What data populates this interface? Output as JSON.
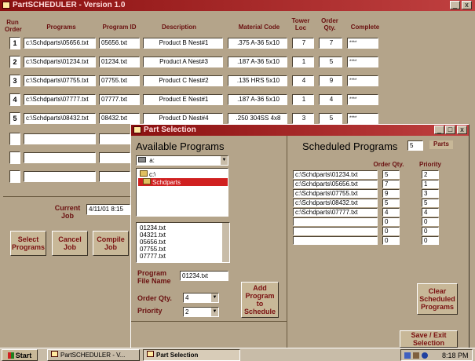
{
  "main_window": {
    "title": "PartSCHEDULER - Version 1.0",
    "headers": {
      "run_order": "Run Order",
      "programs": "Programs",
      "program_id": "Program ID",
      "description": "Description",
      "material_code": "Material Code",
      "tower_loc": "Tower Loc",
      "order_qty": "Order Qty.",
      "complete": "Complete"
    },
    "rows": [
      {
        "order": "1",
        "program": "c:\\Schdparts\\05656.txt",
        "id": "05656.txt",
        "desc": "Product B Nest#1",
        "material": ".375 A-36 5x10",
        "tower": "7",
        "qty": "7",
        "complete": "****"
      },
      {
        "order": "2",
        "program": "c:\\Schdparts\\01234.txt",
        "id": "01234.txt",
        "desc": "Product A Nest#3",
        "material": ".187 A-36 5x10",
        "tower": "1",
        "qty": "5",
        "complete": "****"
      },
      {
        "order": "3",
        "program": "c:\\Schdparts\\07755.txt",
        "id": "07755.txt",
        "desc": "Product C Nest#2",
        "material": ".135 HRS 5x10",
        "tower": "4",
        "qty": "9",
        "complete": "****"
      },
      {
        "order": "4",
        "program": "c:\\Schdparts\\07777.txt",
        "id": "07777.txt",
        "desc": "Product E Nest#1",
        "material": ".187 A-36 5x10",
        "tower": "1",
        "qty": "4",
        "complete": "****"
      },
      {
        "order": "5",
        "program": "c:\\Schdparts\\08432.txt",
        "id": "08432.txt",
        "desc": "Product D Nest#4",
        "material": ".250 304SS 4x8",
        "tower": "3",
        "qty": "5",
        "complete": "****"
      }
    ],
    "current_job_label": "Current Job",
    "current_job_value": "4/11/01 8:15",
    "buttons": {
      "select": "Select Programs",
      "cancel": "Cancel Job",
      "compile": "Compile Job"
    }
  },
  "dialog": {
    "title": "Part Selection",
    "available_title": "Available Programs",
    "drive_value": "a:",
    "folders": [
      "c:\\",
      "Schdparts"
    ],
    "files": [
      "01234.txt",
      "04321.txt",
      "05656.txt",
      "07755.txt",
      "07777.txt"
    ],
    "program_file_label": "Program File Name",
    "program_file_value": "01234.txt",
    "order_qty_label": "Order Qty.",
    "order_qty_value": "4",
    "priority_label": "Priority",
    "priority_value": "2",
    "add_button": "Add Program to Schedule",
    "scheduled_title": "Scheduled Programs",
    "scheduled_count": "5",
    "parts_label": "Parts",
    "col_order_qty": "Order Qty.",
    "col_priority": "Priority",
    "scheduled": [
      {
        "file": "c:\\Schdparts\\01234.txt",
        "qty": "5",
        "priority": "2"
      },
      {
        "file": "c:\\Schdparts\\05656.txt",
        "qty": "7",
        "priority": "1"
      },
      {
        "file": "c:\\Schdparts\\07755.txt",
        "qty": "9",
        "priority": "3"
      },
      {
        "file": "c:\\Schdparts\\08432.txt",
        "qty": "5",
        "priority": "5"
      },
      {
        "file": "c:\\Schdparts\\07777.txt",
        "qty": "4",
        "priority": "4"
      },
      {
        "file": "",
        "qty": "0",
        "priority": "0"
      },
      {
        "file": "",
        "qty": "0",
        "priority": "0"
      },
      {
        "file": "",
        "qty": "0",
        "priority": "0"
      }
    ],
    "clear_button": "Clear Scheduled Programs",
    "save_exit_button": "Save / Exit Selection"
  },
  "taskbar": {
    "start": "Start",
    "task1": "PartSCHEDULER - V...",
    "task2": "Part Selection",
    "time": "8:18 PM"
  },
  "colors": {
    "accent": "#7a1010",
    "background": "#b4a48a"
  }
}
